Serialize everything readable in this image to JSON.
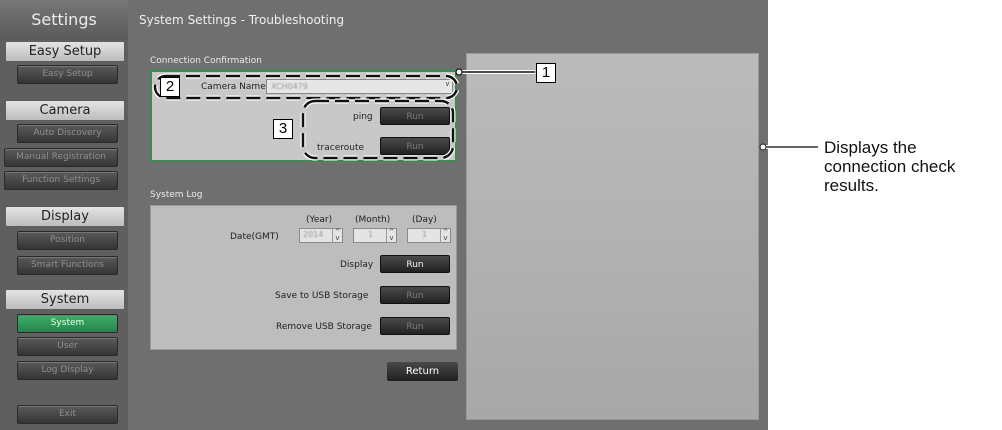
{
  "sidebar": {
    "title": "Settings",
    "sections": [
      {
        "label": "Easy Setup",
        "items": [
          {
            "label": "Easy Setup",
            "active": false
          }
        ]
      },
      {
        "label": "Camera",
        "items": [
          {
            "label": "Auto Discovery",
            "active": false
          },
          {
            "label": "Manual Registration",
            "active": false
          },
          {
            "label": "Function Settings",
            "active": false
          }
        ]
      },
      {
        "label": "Display",
        "items": [
          {
            "label": "Position",
            "active": false
          },
          {
            "label": "Smart Functions",
            "active": false
          }
        ]
      },
      {
        "label": "System",
        "items": [
          {
            "label": "System",
            "active": true
          },
          {
            "label": "User",
            "active": false
          },
          {
            "label": "Log Display",
            "active": false
          }
        ]
      }
    ],
    "exit_label": "Exit"
  },
  "page_title": "System Settings - Troubleshooting",
  "connection": {
    "title": "Connection Confirmation",
    "camera_name_label": "Camera Name",
    "camera_name_value": "XCH0479",
    "ping_label": "ping",
    "ping_button": "Run",
    "traceroute_label": "traceroute",
    "traceroute_button": "Run"
  },
  "system_log": {
    "title": "System Log",
    "date_label": "Date(GMT)",
    "year_header": "(Year)",
    "month_header": "(Month)",
    "day_header": "(Day)",
    "year_value": "2014",
    "month_value": "1",
    "day_value": "1",
    "display_label": "Display",
    "display_button": "Run",
    "save_label": "Save to USB Storage",
    "save_button": "Run",
    "remove_label": "Remove USB Storage",
    "remove_button": "Run"
  },
  "return_button": "Return",
  "annotations": {
    "n1": "1",
    "n2": "2",
    "n3": "3",
    "result_note": "Displays the connection check results."
  },
  "colors": {
    "active_green": "#2f9c5a",
    "panel_border_green": "#3a8c4c"
  }
}
